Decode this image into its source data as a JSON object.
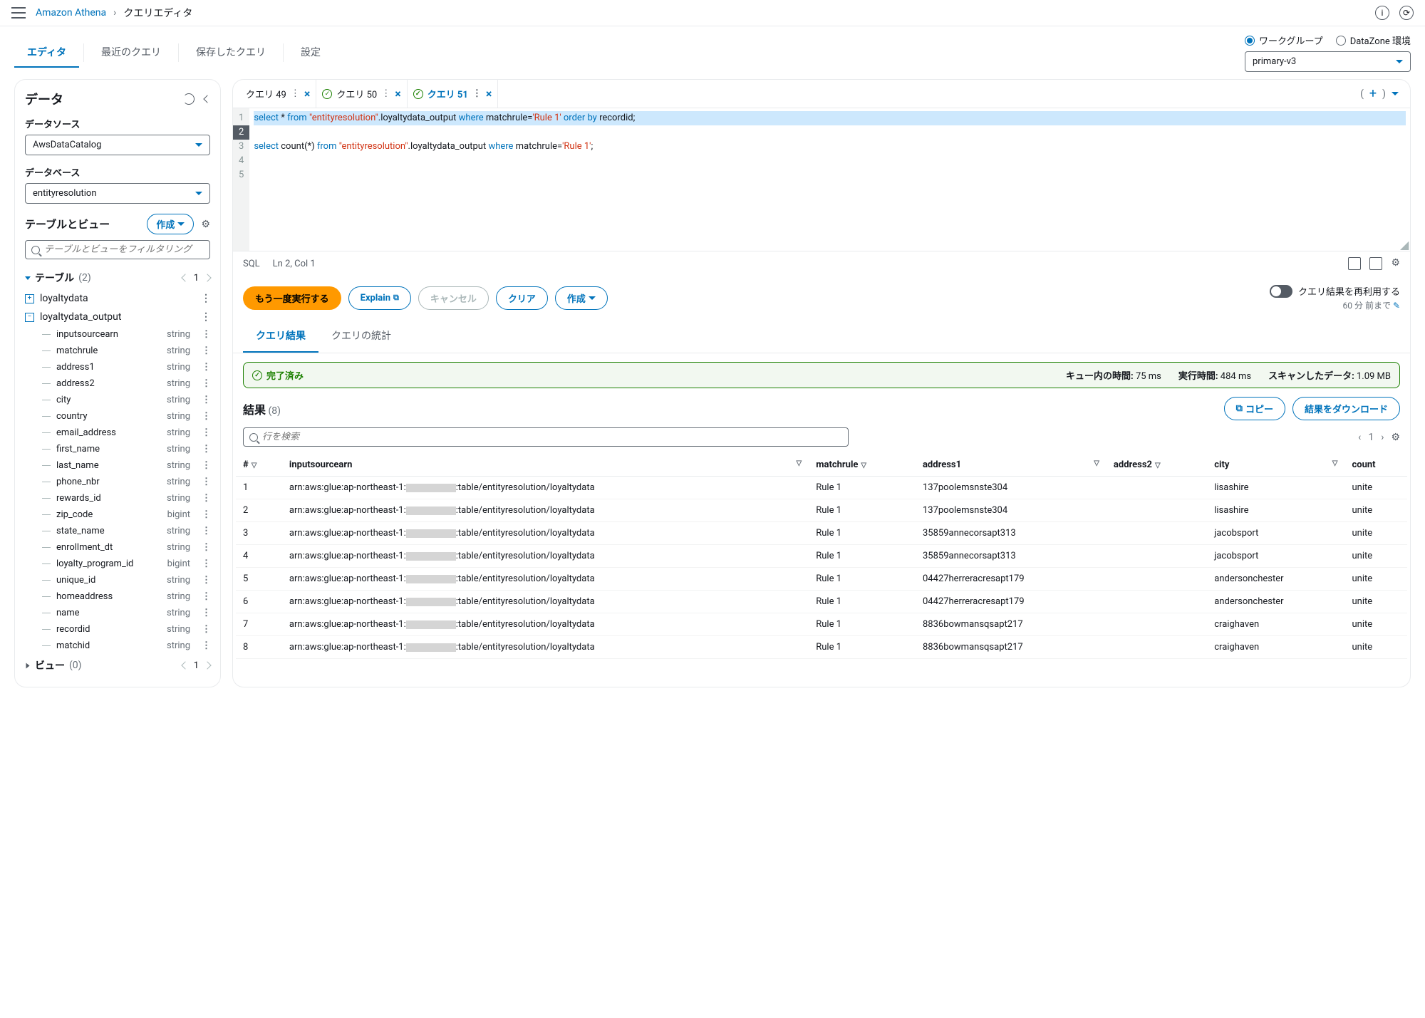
{
  "breadcrumb": {
    "service": "Amazon Athena",
    "page": "クエリエディタ"
  },
  "tabs": {
    "editor": "エディタ",
    "recent": "最近のクエリ",
    "saved": "保存したクエリ",
    "settings": "設定"
  },
  "workgroup": {
    "radio_workgroup": "ワークグループ",
    "radio_datazone": "DataZone 環境",
    "selected": "primary-v3"
  },
  "sidebar": {
    "title": "データ",
    "datasource_label": "データソース",
    "datasource_value": "AwsDataCatalog",
    "database_label": "データベース",
    "database_value": "entityresolution",
    "tables_views_title": "テーブルとビュー",
    "create_btn": "作成",
    "filter_placeholder": "テーブルとビューをフィルタリング",
    "tables_label": "テーブル",
    "tables_count": "(2)",
    "tables_page": "1",
    "table1": "loyaltydata",
    "table2": "loyaltydata_output",
    "columns": [
      {
        "name": "inputsourcearn",
        "type": "string"
      },
      {
        "name": "matchrule",
        "type": "string"
      },
      {
        "name": "address1",
        "type": "string"
      },
      {
        "name": "address2",
        "type": "string"
      },
      {
        "name": "city",
        "type": "string"
      },
      {
        "name": "country",
        "type": "string"
      },
      {
        "name": "email_address",
        "type": "string"
      },
      {
        "name": "first_name",
        "type": "string"
      },
      {
        "name": "last_name",
        "type": "string"
      },
      {
        "name": "phone_nbr",
        "type": "string"
      },
      {
        "name": "rewards_id",
        "type": "string"
      },
      {
        "name": "zip_code",
        "type": "bigint"
      },
      {
        "name": "state_name",
        "type": "string"
      },
      {
        "name": "enrollment_dt",
        "type": "string"
      },
      {
        "name": "loyalty_program_id",
        "type": "bigint"
      },
      {
        "name": "unique_id",
        "type": "string"
      },
      {
        "name": "homeaddress",
        "type": "string"
      },
      {
        "name": "name",
        "type": "string"
      },
      {
        "name": "recordid",
        "type": "string"
      },
      {
        "name": "matchid",
        "type": "string"
      }
    ],
    "views_label": "ビュー",
    "views_count": "(0)",
    "views_page": "1"
  },
  "editor": {
    "tabs": [
      {
        "name": "クエリ 49",
        "status": "none",
        "active": false
      },
      {
        "name": "クエリ 50",
        "status": "ok",
        "active": false
      },
      {
        "name": "クエリ 51",
        "status": "ok",
        "active": true
      }
    ],
    "code": {
      "line1_a": "select",
      "line1_b": " * ",
      "line1_c": "from",
      "line1_d": " \"entityresolution\"",
      "line1_e": ".loyaltydata_output ",
      "line1_f": "where",
      "line1_g": " matchrule=",
      "line1_h": "'Rule 1'",
      "line1_i": " order by",
      "line1_j": " recordid;",
      "line3_a": "select",
      "line3_b": " count(*) ",
      "line3_c": "from",
      "line3_d": " \"entityresolution\"",
      "line3_e": ".loyaltydata_output ",
      "line3_f": "where",
      "line3_g": " matchrule=",
      "line3_h": "'Rule 1'",
      "line3_i": ";"
    },
    "lang": "SQL",
    "cursor": "Ln 2, Col 1"
  },
  "actions": {
    "run": "もう一度実行する",
    "explain": "Explain",
    "cancel": "キャンセル",
    "clear": "クリア",
    "create": "作成",
    "reuse_label": "クエリ結果を再利用する",
    "reuse_time": "60 分 前まで"
  },
  "result_tabs": {
    "results": "クエリ結果",
    "stats": "クエリの統計"
  },
  "banner": {
    "status": "完了済み",
    "queue_label": "キュー内の時間:",
    "queue_value": "75 ms",
    "run_label": "実行時間:",
    "run_value": "484 ms",
    "scan_label": "スキャンしたデータ:",
    "scan_value": "1.09 MB"
  },
  "results": {
    "title": "結果",
    "count": "(8)",
    "copy_btn": "コピー",
    "download_btn": "結果をダウンロード",
    "search_placeholder": "行を検索",
    "page": "1",
    "headers": {
      "num": "#",
      "inputsourcearn": "inputsourcearn",
      "matchrule": "matchrule",
      "address1": "address1",
      "address2": "address2",
      "city": "city",
      "country": "count"
    },
    "arn_prefix": "arn:aws:glue:ap-northeast-1:",
    "arn_suffix": ":table/entityresolution/loyaltydata",
    "rows": [
      {
        "num": "1",
        "matchrule": "Rule 1",
        "address1": "137poolemsnste304",
        "address2": "",
        "city": "lisashire",
        "country": "unite"
      },
      {
        "num": "2",
        "matchrule": "Rule 1",
        "address1": "137poolemsnste304",
        "address2": "",
        "city": "lisashire",
        "country": "unite"
      },
      {
        "num": "3",
        "matchrule": "Rule 1",
        "address1": "35859annecorsapt313",
        "address2": "",
        "city": "jacobsport",
        "country": "unite"
      },
      {
        "num": "4",
        "matchrule": "Rule 1",
        "address1": "35859annecorsapt313",
        "address2": "",
        "city": "jacobsport",
        "country": "unite"
      },
      {
        "num": "5",
        "matchrule": "Rule 1",
        "address1": "04427herreracresapt179",
        "address2": "",
        "city": "andersonchester",
        "country": "unite"
      },
      {
        "num": "6",
        "matchrule": "Rule 1",
        "address1": "04427herreracresapt179",
        "address2": "",
        "city": "andersonchester",
        "country": "unite"
      },
      {
        "num": "7",
        "matchrule": "Rule 1",
        "address1": "8836bowmansqsapt217",
        "address2": "",
        "city": "craighaven",
        "country": "unite"
      },
      {
        "num": "8",
        "matchrule": "Rule 1",
        "address1": "8836bowmansqsapt217",
        "address2": "",
        "city": "craighaven",
        "country": "unite"
      }
    ]
  }
}
